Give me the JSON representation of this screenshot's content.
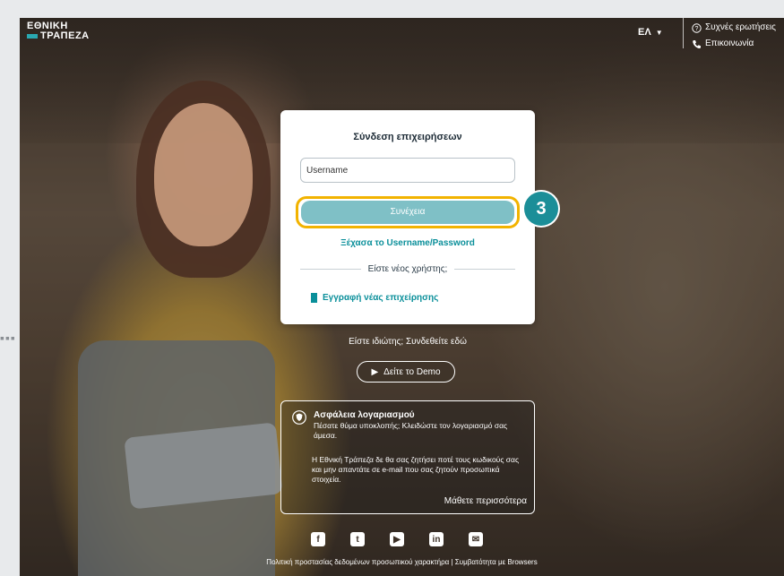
{
  "logo": {
    "line1": "ΕΘΝΙΚΗ",
    "line2": "ΤΡΑΠΕΖΑ"
  },
  "header": {
    "language": "ΕΛ",
    "faq": "Συχνές ερωτήσεις",
    "contact": "Επικοινωνία"
  },
  "login": {
    "title": "Σύνδεση επιχειρήσεων",
    "username_placeholder": "Username",
    "username_value": "",
    "continue_label": "Συνέχεια",
    "forgot_label": "Ξέχασα το Username/Password",
    "new_user_label": "Είστε νέος χρήστης;",
    "register_label": "Εγγραφή νέας επιχείρησης"
  },
  "step_marker": "3",
  "individual_link": "Είστε ιδιώτης; Συνδεθείτε εδώ",
  "demo_button": "Δείτε το Demo",
  "security": {
    "title": "Ασφάλεια λογαριασμού",
    "text1": "Πέσατε θύμα υποκλοπής; Κλειδώστε τον λογαριασμό σας άμεσα.",
    "text2": "Η Εθνική Τράπεζα δε θα σας ζητήσει ποτέ τους κωδικούς σας και μην απαντάτε σε e-mail που σας ζητούν προσωπικά στοιχεία.",
    "more": "Μάθετε περισσότερα"
  },
  "social": [
    {
      "icon": "facebook-icon",
      "glyph": "f"
    },
    {
      "icon": "twitter-icon",
      "glyph": "t"
    },
    {
      "icon": "youtube-icon",
      "glyph": "▶"
    },
    {
      "icon": "linkedin-icon",
      "glyph": "in"
    },
    {
      "icon": "email-icon",
      "glyph": "✉"
    }
  ],
  "footer": "Πολιτική προστασίας δεδομένων προσωπικού χαρακτήρα | Συμβατότητα με Browsers",
  "colors": {
    "accent": "#0a8f9a",
    "button": "#7fc0c6",
    "highlight": "#f2b300",
    "step": "#1b8e98"
  }
}
